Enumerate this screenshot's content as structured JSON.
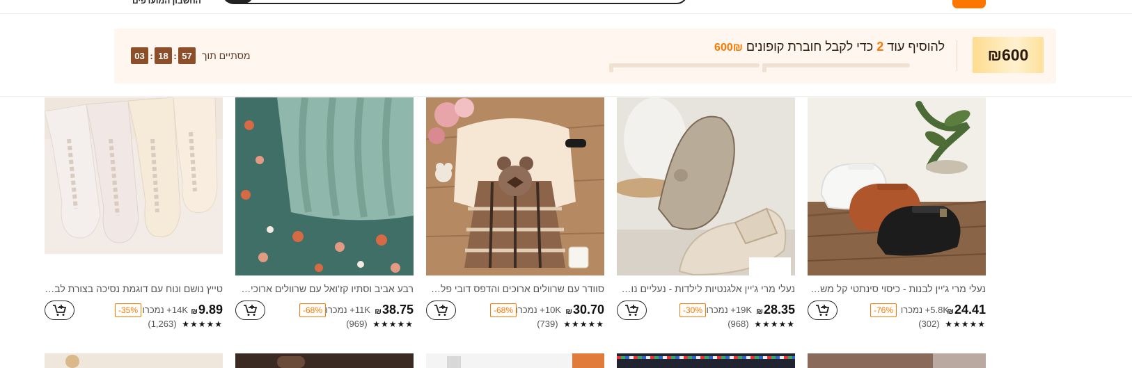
{
  "header": {
    "link_text": "החשבון המועדפים",
    "brand_color": "#fb7701"
  },
  "coupon": {
    "amount": "₪600",
    "message_prefix": "להוסיף עוד",
    "message_count": "2",
    "message_middle": "כדי לקבל חוברת קופונים",
    "message_amount": "600₪",
    "ends_label": "מסתיים תוך",
    "timer": {
      "hours": "03",
      "minutes": "18",
      "seconds": "57"
    }
  },
  "products": [
    {
      "title": "נעלי מרי ג'יין לבנות - כיסוי סינתטי קל משקל, סוליית גומי, נעליים יומיומיות",
      "price": "24.41",
      "currency": "₪",
      "sold": "5.8K+ נמכרו",
      "discount": "-76%",
      "stars": "★★★★★",
      "reviews": "(302)",
      "image": "shoes-tbar-three-colors"
    },
    {
      "title": "נעלי מרי ג'יין אלגנטיות לילדות - נעליים נוחות לכל יום",
      "price": "28.35",
      "currency": "₪",
      "sold": "19K+ נמכרו",
      "discount": "-30%",
      "stars": "★★★★★",
      "reviews": "(968)",
      "image": "beige-patent-shoes"
    },
    {
      "title": "סוודר עם שרוולים ארוכים והדפס דובי פלאיד וחצאית משובצת",
      "price": "30.70",
      "currency": "₪",
      "sold": "10K+ נמכרו",
      "discount": "-68%",
      "stars": "★★★★★",
      "reviews": "(739)",
      "image": "bear-sweater-plaid-skirt"
    },
    {
      "title": "רבע אביב וסתיו קז'ואל עם שרוולים ארוכים וחצאית פרחונית",
      "price": "38.75",
      "currency": "₪",
      "sold": "11K+ נמכרו",
      "discount": "-68%",
      "stars": "★★★★★",
      "reviews": "(969)",
      "image": "teal-knit-floral-skirt"
    },
    {
      "title": "טייץ נושם ונוח עם דוגמת נסיכה בצורת לב, בנות",
      "price": "9.89",
      "currency": "₪",
      "sold": "14K+ נמכרו",
      "discount": "-35%",
      "stars": "★★★★★",
      "reviews": "(1,263)",
      "image": "lace-tights"
    }
  ],
  "icons": {
    "cart": "add-to-cart-icon",
    "star": "star-icon"
  }
}
